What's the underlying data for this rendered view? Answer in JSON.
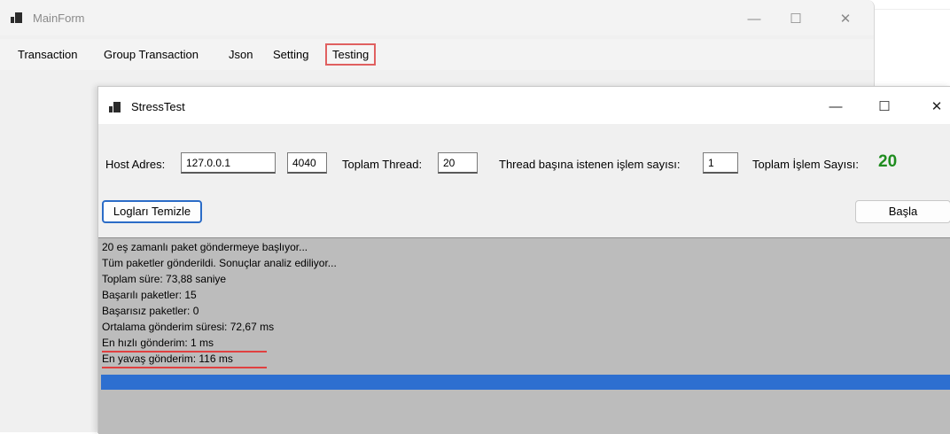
{
  "main_window": {
    "title": "MainForm",
    "minimize_glyph": "—",
    "maximize_glyph": "☐",
    "close_glyph": "✕"
  },
  "menu": {
    "items": [
      {
        "label": "Transaction"
      },
      {
        "label": "Group Transaction"
      },
      {
        "label": "Json"
      },
      {
        "label": "Setting"
      },
      {
        "label": "Testing",
        "selected": true
      }
    ]
  },
  "stress_window": {
    "title": "StressTest",
    "minimize_glyph": "—",
    "maximize_glyph": "☐",
    "close_glyph": "✕",
    "host_label": "Host Adres:",
    "host_value": "127.0.0.1",
    "port_value": "4040",
    "thread_label": "Toplam Thread:",
    "thread_value": "20",
    "per_thread_label": "Thread başına istenen işlem sayısı:",
    "per_thread_value": "1",
    "total_label": "Toplam İşlem Sayısı:",
    "total_value": "20",
    "clear_button": "Logları Temizle",
    "start_button": "Başla"
  },
  "log": {
    "lines": [
      "20 eş zamanlı paket göndermeye başlıyor...",
      "Tüm paketler gönderildi. Sonuçlar analiz ediliyor...",
      "Toplam süre: 73,88 saniye",
      "Başarılı paketler: 15",
      "Başarısız paketler: 0",
      "Ortalama gönderim süresi: 72,67 ms",
      "En hızlı gönderim: 1 ms",
      "En yavaş gönderim: 116 ms"
    ],
    "highlight_color": "#2d6fd0",
    "underline_color": "#e04040"
  },
  "colors": {
    "total_count": "#1e8c1e",
    "selected_menu_border": "#e06060",
    "focused_button_border": "#2b6cc7"
  }
}
